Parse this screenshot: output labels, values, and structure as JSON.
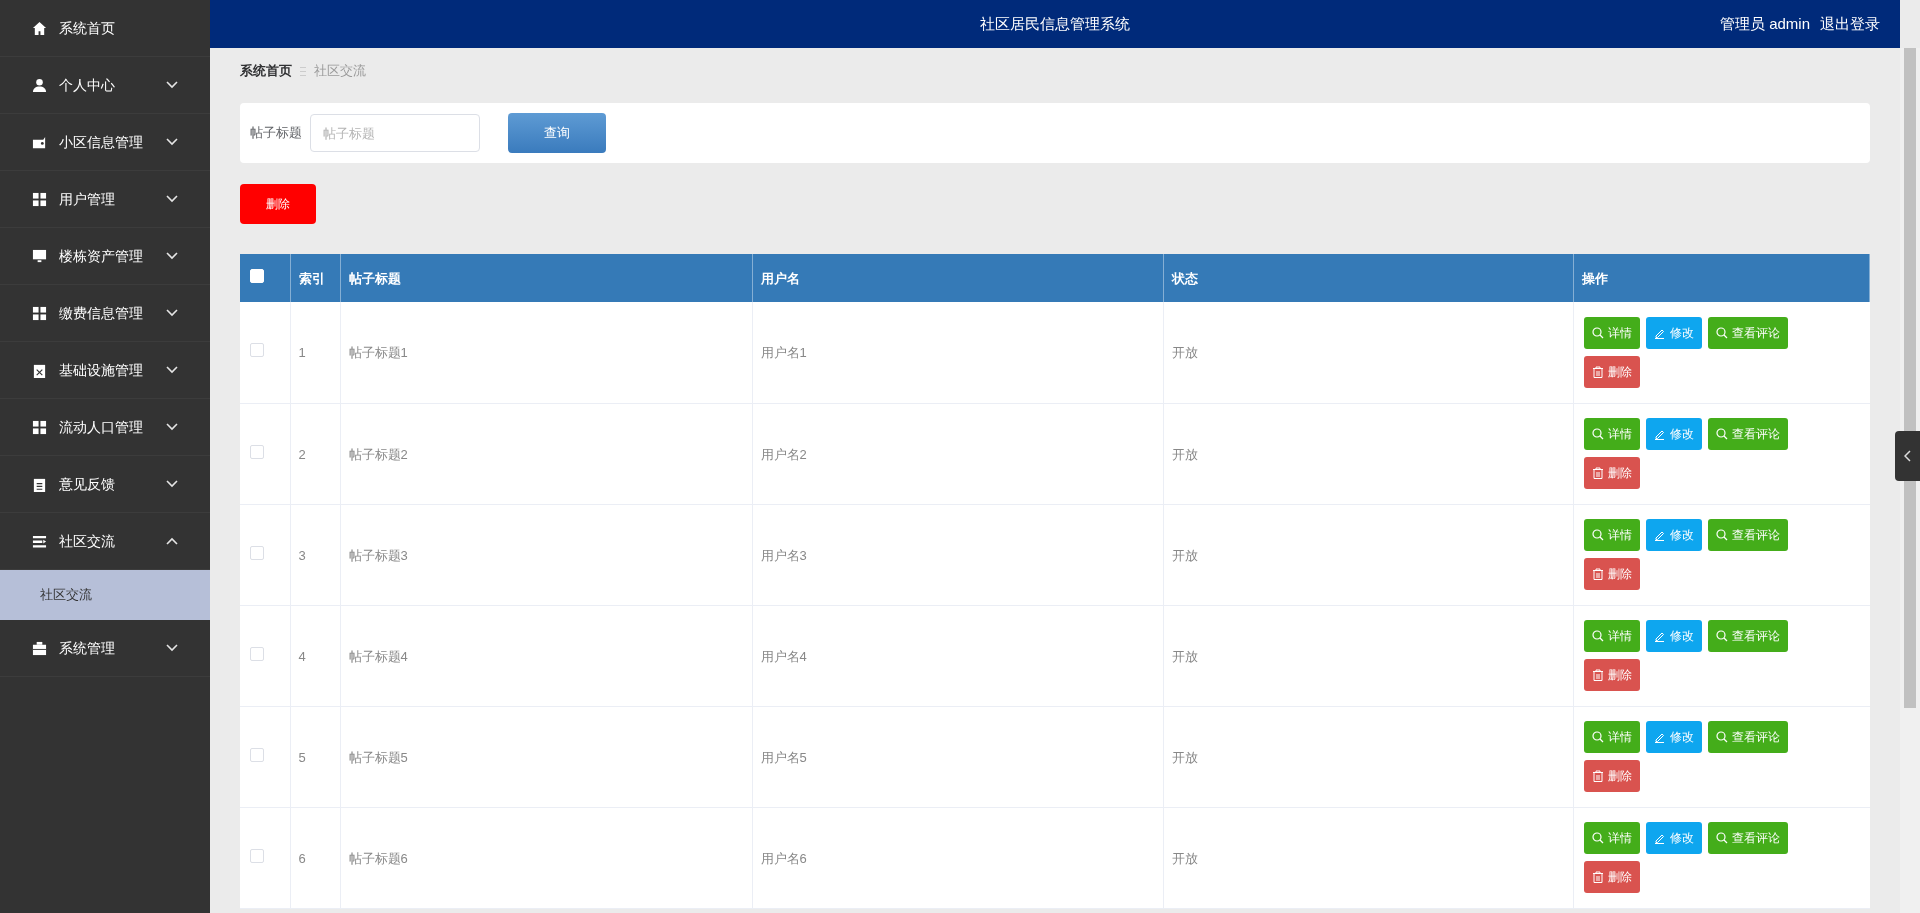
{
  "sidebar": {
    "items": [
      {
        "kind": "link",
        "label": "系统首页"
      },
      {
        "kind": "menu",
        "label": "个人中心",
        "expanded": false
      },
      {
        "kind": "menu",
        "label": "小区信息管理",
        "expanded": false
      },
      {
        "kind": "menu",
        "label": "用户管理",
        "expanded": false
      },
      {
        "kind": "menu",
        "label": "楼栋资产管理",
        "expanded": false
      },
      {
        "kind": "menu",
        "label": "缴费信息管理",
        "expanded": false
      },
      {
        "kind": "menu",
        "label": "基础设施管理",
        "expanded": false
      },
      {
        "kind": "menu",
        "label": "流动人口管理",
        "expanded": false
      },
      {
        "kind": "menu",
        "label": "意见反馈",
        "expanded": false
      },
      {
        "kind": "menu",
        "label": "社区交流",
        "expanded": true,
        "children": [
          {
            "label": "社区交流",
            "selected": true
          }
        ]
      },
      {
        "kind": "menu",
        "label": "系统管理",
        "expanded": false
      }
    ]
  },
  "header": {
    "title": "社区居民信息管理系统",
    "user": "管理员 admin",
    "logout": "退出登录"
  },
  "breadcrumb": [
    "系统首页",
    "社区交流"
  ],
  "search": {
    "label": "帖子标题",
    "placeholder": "帖子标题",
    "button": "查询"
  },
  "delete_button": "删除",
  "table": {
    "select_all_checked": false,
    "columns": [
      "索引",
      "帖子标题",
      "用户名",
      "状态",
      "操作"
    ],
    "rows": [
      {
        "checked": false,
        "index": "1",
        "title": "帖子标题1",
        "user": "用户名1",
        "status": "开放",
        "actions": [
          "详情",
          "修改",
          "查看评论",
          "删除"
        ]
      },
      {
        "checked": false,
        "index": "2",
        "title": "帖子标题2",
        "user": "用户名2",
        "status": "开放",
        "actions": [
          "详情",
          "修改",
          "查看评论",
          "删除"
        ]
      },
      {
        "checked": false,
        "index": "3",
        "title": "帖子标题3",
        "user": "用户名3",
        "status": "开放",
        "actions": [
          "详情",
          "修改",
          "查看评论",
          "删除"
        ]
      },
      {
        "checked": false,
        "index": "4",
        "title": "帖子标题4",
        "user": "用户名4",
        "status": "开放",
        "actions": [
          "详情",
          "修改",
          "查看评论",
          "删除"
        ]
      },
      {
        "checked": false,
        "index": "5",
        "title": "帖子标题5",
        "user": "用户名5",
        "status": "开放",
        "actions": [
          "详情",
          "修改",
          "查看评论",
          "删除"
        ]
      },
      {
        "checked": false,
        "index": "6",
        "title": "帖子标题6",
        "user": "用户名6",
        "status": "开放",
        "actions": [
          "详情",
          "修改",
          "查看评论",
          "删除"
        ]
      }
    ]
  }
}
